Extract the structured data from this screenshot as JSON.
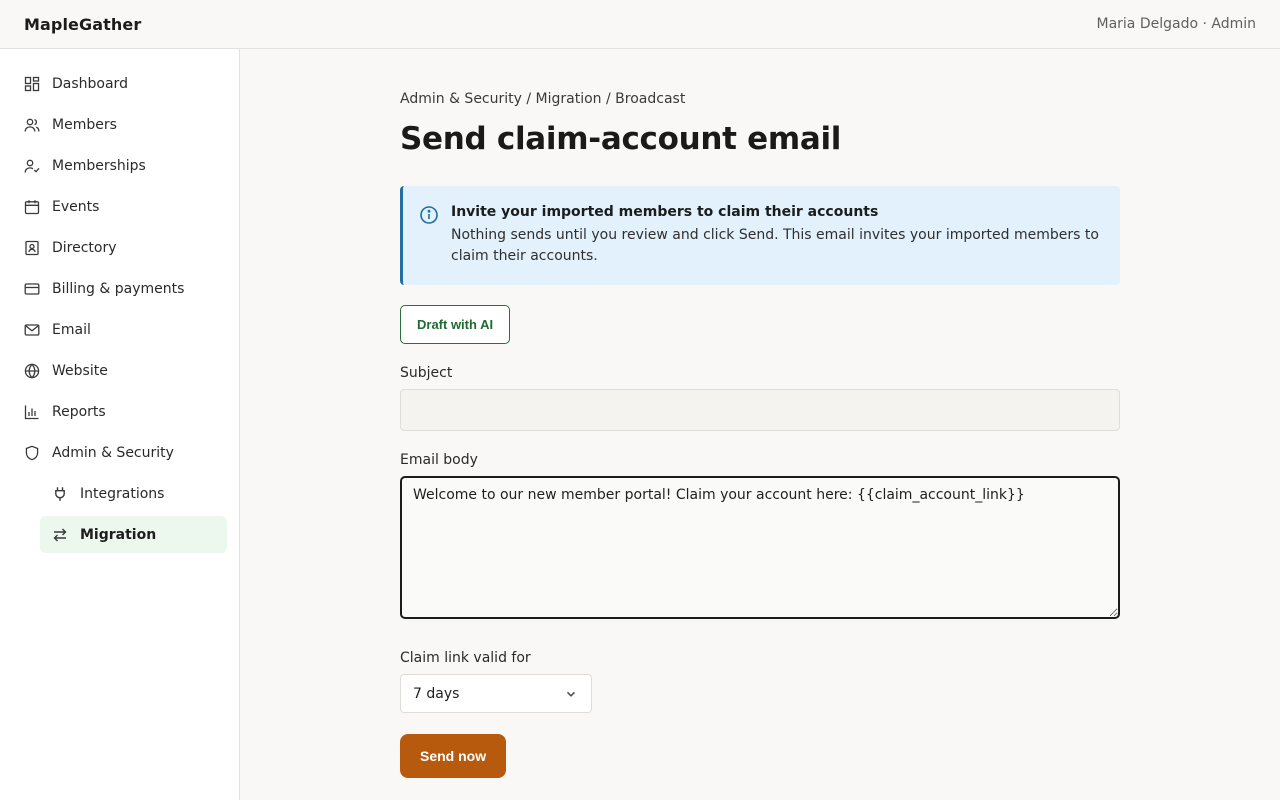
{
  "app": {
    "brand": "MapleGather",
    "user": "Maria Delgado · Admin"
  },
  "sidebar": {
    "items": [
      {
        "label": "Dashboard",
        "icon": "dashboard-icon"
      },
      {
        "label": "Members",
        "icon": "members-icon"
      },
      {
        "label": "Memberships",
        "icon": "memberships-icon"
      },
      {
        "label": "Events",
        "icon": "calendar-icon"
      },
      {
        "label": "Directory",
        "icon": "directory-icon"
      },
      {
        "label": "Billing & payments",
        "icon": "credit-card-icon"
      },
      {
        "label": "Email",
        "icon": "mail-icon"
      },
      {
        "label": "Website",
        "icon": "globe-icon"
      },
      {
        "label": "Reports",
        "icon": "bar-chart-icon"
      },
      {
        "label": "Admin & Security",
        "icon": "shield-icon"
      }
    ],
    "sub_items": [
      {
        "label": "Integrations",
        "icon": "plug-icon"
      },
      {
        "label": "Migration",
        "icon": "arrows-swap-icon",
        "active": true
      }
    ]
  },
  "main": {
    "breadcrumb": "Admin & Security / Migration / Broadcast",
    "title": "Send claim-account email",
    "callout": {
      "title": "Invite your imported members to claim their accounts",
      "text": "Nothing sends until you review and click Send. This email invites your imported members to claim their accounts."
    },
    "draft_ai_label": "Draft with AI",
    "subject": {
      "label": "Subject",
      "value": "",
      "placeholder": ""
    },
    "body": {
      "label": "Email body",
      "value": "Welcome to our new member portal! Claim your account here: {{claim_account_link}}"
    },
    "claim_validity": {
      "label": "Claim link valid for",
      "selected": "7 days"
    },
    "send_label": "Send now"
  },
  "colors": {
    "accent_green": "#1f6b30",
    "send_orange": "#b85a0e",
    "info_blue": "#1f6fa0",
    "callout_bg": "#e2f1fb",
    "active_nav_bg": "#ecf7ee"
  }
}
